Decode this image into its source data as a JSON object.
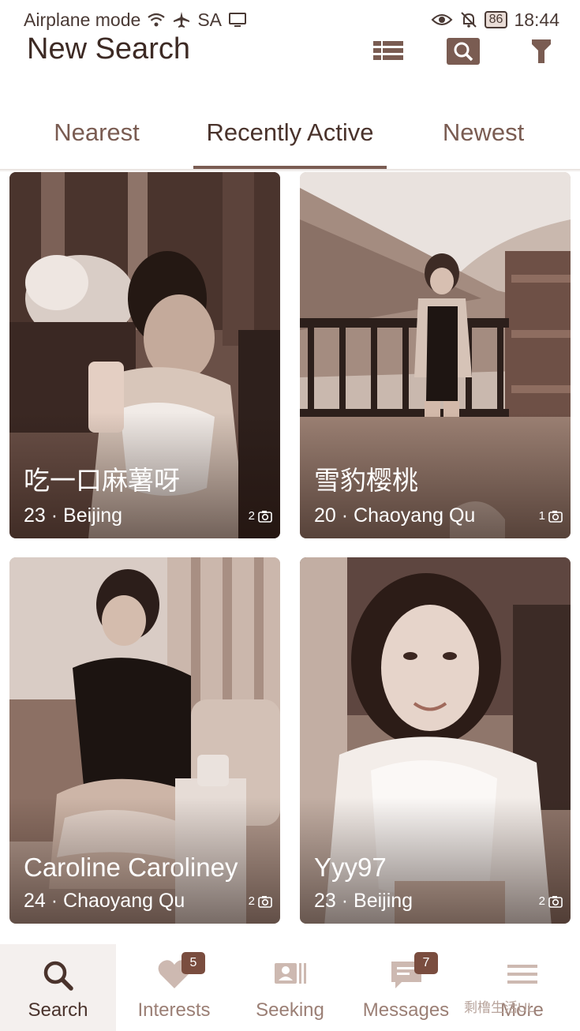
{
  "status_bar": {
    "mode": "Airplane mode",
    "sim": "SA",
    "battery": "86",
    "time": "18:44"
  },
  "header": {
    "title": "New Search",
    "icons": [
      "list-view-icon",
      "search-icon",
      "filter-icon"
    ]
  },
  "tabs": [
    {
      "label": "Nearest"
    },
    {
      "label": "Recently Active",
      "active": true
    },
    {
      "label": "Newest"
    }
  ],
  "profiles": [
    {
      "name": "吃一口麻薯呀",
      "meta": "23 · Beijing",
      "photos": "2"
    },
    {
      "name": "雪豹樱桃",
      "meta": "20 · Chaoyang Qu",
      "photos": "1"
    },
    {
      "name": "Caroline Caroliney",
      "meta": "24 · Chaoyang Qu",
      "photos": "2"
    },
    {
      "name": "Yyy97",
      "meta": "23 · Beijing",
      "photos": "2"
    }
  ],
  "bottom_nav": [
    {
      "label": "Search",
      "icon": "search-icon",
      "active": true
    },
    {
      "label": "Interests",
      "icon": "heart-icon",
      "badge": "5"
    },
    {
      "label": "Seeking",
      "icon": "id-card-icon"
    },
    {
      "label": "Messages",
      "icon": "chat-icon",
      "badge": "7"
    },
    {
      "label": "More",
      "icon": "menu-icon"
    }
  ],
  "watermark": "剩橹生活UL",
  "colors": {
    "accent": "#7a5c52",
    "badge": "#7a4d3f",
    "text_dark": "#3d2a24",
    "text_muted": "#9b7f75"
  }
}
